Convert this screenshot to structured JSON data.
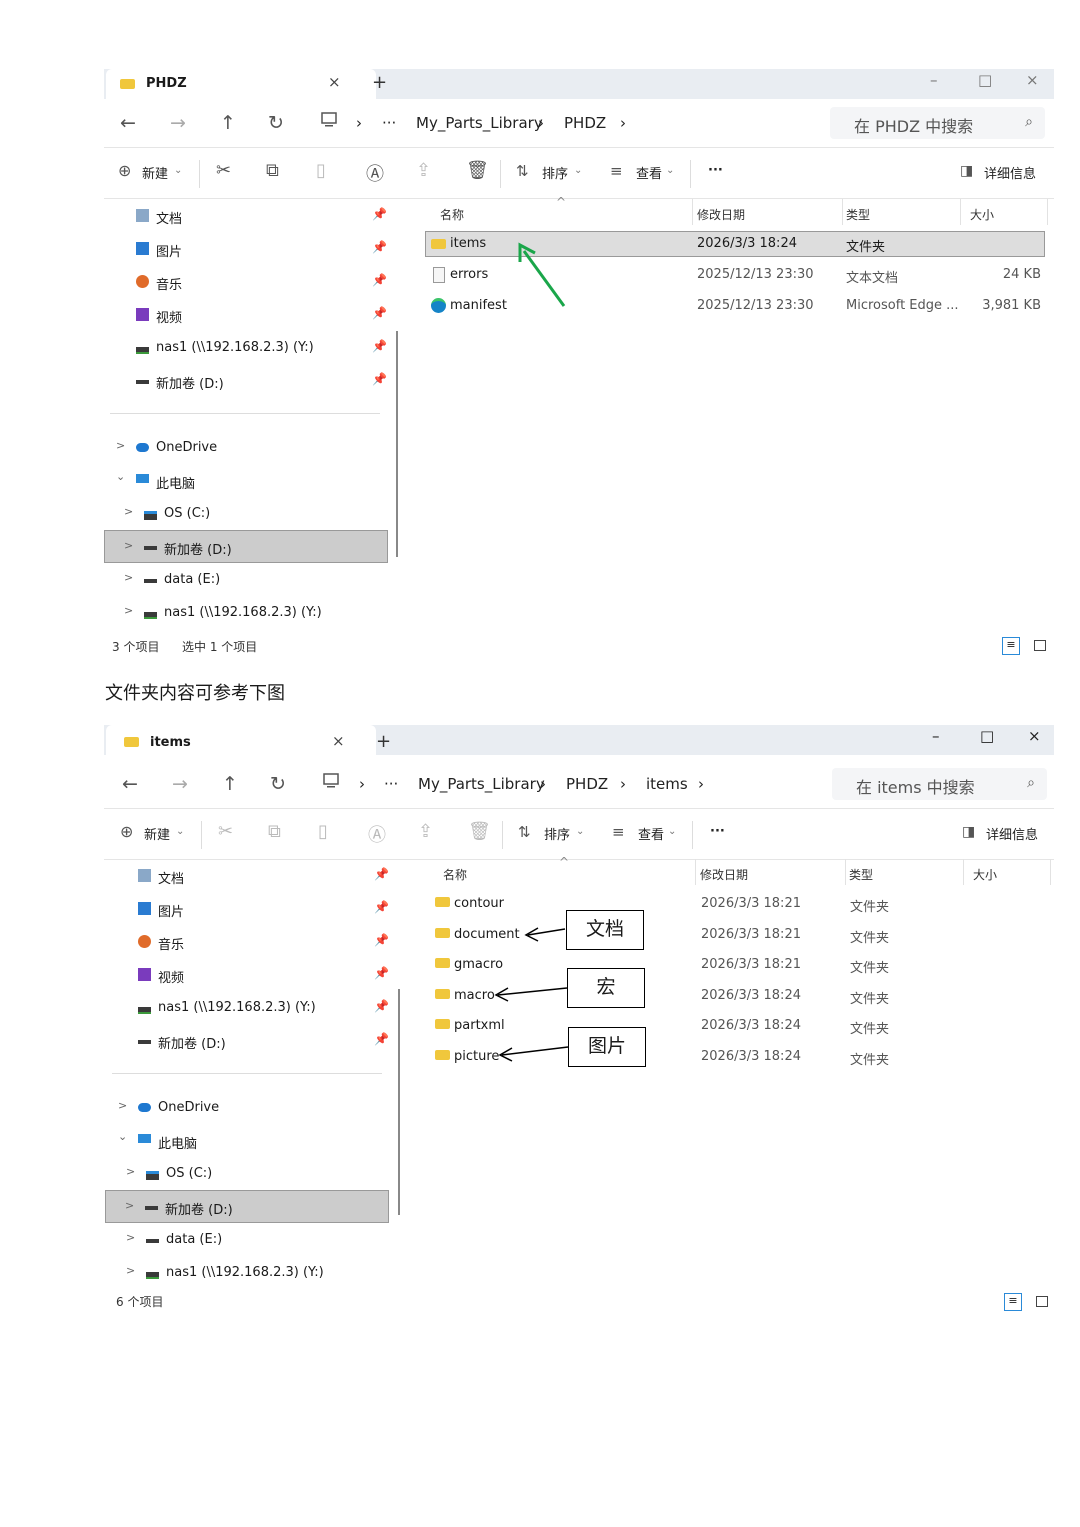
{
  "caption": "文件夹内容可参考下图",
  "window1": {
    "tab_title": "PHDZ",
    "tab_close": "×",
    "tab_add": "+",
    "win_min": "–",
    "win_max": "□",
    "win_close": "×",
    "more": "···",
    "crumbs": [
      "My_Parts_Library",
      "PHDZ"
    ],
    "search_placeholder": "在 PHDZ 中搜索",
    "new_label": "新建",
    "sort_label": "排序",
    "view_label": "查看",
    "toolbar_more": "···",
    "details_label": "详细信息",
    "quick_access": [
      {
        "label": "文档"
      },
      {
        "label": "图片"
      },
      {
        "label": "音乐"
      },
      {
        "label": "视频"
      },
      {
        "label": "nas1 (\\\\192.168.2.3) (Y:)"
      },
      {
        "label": "新加卷 (D:)"
      }
    ],
    "tree": [
      {
        "label": "OneDrive",
        "chev": ">"
      },
      {
        "label": "此电脑",
        "chev": "⌄"
      },
      {
        "label": "OS (C:)",
        "chev": ">"
      },
      {
        "label": "新加卷 (D:)",
        "chev": ">"
      },
      {
        "label": "data (E:)",
        "chev": ">"
      },
      {
        "label": "nas1 (\\\\192.168.2.3) (Y:)",
        "chev": ">"
      }
    ],
    "columns": {
      "name": "名称",
      "date": "修改日期",
      "type": "类型",
      "size": "大小"
    },
    "files": [
      {
        "name": "items",
        "date": "2026/3/3 18:24",
        "type": "文件夹",
        "size": "",
        "icon": "folder-icon"
      },
      {
        "name": "errors",
        "date": "2025/12/13 23:30",
        "type": "文本文档",
        "size": "24 KB",
        "icon": "text-file-icon"
      },
      {
        "name": "manifest",
        "date": "2025/12/13 23:30",
        "type": "Microsoft Edge ...",
        "size": "3,981 KB",
        "icon": "edge-icon"
      }
    ],
    "status_count": "3 个项目",
    "status_selected": "选中 1 个项目"
  },
  "window2": {
    "tab_title": "items",
    "tab_close": "×",
    "tab_add": "+",
    "win_min": "–",
    "win_max": "□",
    "win_close": "×",
    "more": "···",
    "crumbs": [
      "My_Parts_Library",
      "PHDZ",
      "items"
    ],
    "search_placeholder": "在 items 中搜索",
    "new_label": "新建",
    "sort_label": "排序",
    "view_label": "查看",
    "toolbar_more": "···",
    "details_label": "详细信息",
    "quick_access": [
      {
        "label": "文档"
      },
      {
        "label": "图片"
      },
      {
        "label": "音乐"
      },
      {
        "label": "视频"
      },
      {
        "label": "nas1 (\\\\192.168.2.3) (Y:)"
      },
      {
        "label": "新加卷 (D:)"
      }
    ],
    "tree": [
      {
        "label": "OneDrive",
        "chev": ">"
      },
      {
        "label": "此电脑",
        "chev": "⌄"
      },
      {
        "label": "OS (C:)",
        "chev": ">"
      },
      {
        "label": "新加卷 (D:)",
        "chev": ">"
      },
      {
        "label": "data (E:)",
        "chev": ">"
      },
      {
        "label": "nas1 (\\\\192.168.2.3) (Y:)",
        "chev": ">"
      }
    ],
    "columns": {
      "name": "名称",
      "date": "修改日期",
      "type": "类型",
      "size": "大小"
    },
    "files": [
      {
        "name": "contour",
        "date": "2026/3/3 18:21",
        "type": "文件夹",
        "size": ""
      },
      {
        "name": "document",
        "date": "2026/3/3 18:21",
        "type": "文件夹",
        "size": ""
      },
      {
        "name": "gmacro",
        "date": "2026/3/3 18:21",
        "type": "文件夹",
        "size": ""
      },
      {
        "name": "macro",
        "date": "2026/3/3 18:24",
        "type": "文件夹",
        "size": ""
      },
      {
        "name": "partxml",
        "date": "2026/3/3 18:24",
        "type": "文件夹",
        "size": ""
      },
      {
        "name": "picture",
        "date": "2026/3/3 18:24",
        "type": "文件夹",
        "size": ""
      }
    ],
    "status_count": "6 个项目"
  },
  "annotations": {
    "document": "文档",
    "macro": "宏",
    "picture": "图片"
  },
  "colors": {
    "arrow_green": "#1aa64a",
    "selection": "#cccccc",
    "folder": "#f0c73c"
  }
}
